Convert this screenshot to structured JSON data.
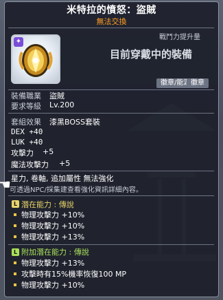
{
  "item": {
    "name": "米特拉的憤怒：盜賊",
    "trade": "無法交換",
    "power_label": "戰鬥力提升量",
    "wearing_label": "目前穿戴中的裝備",
    "tags": [
      "徽章/能源",
      "徽章"
    ]
  },
  "stats": {
    "job_label": "裝備職業",
    "job_value": "盜賊",
    "level_label": "要求等級",
    "level_value": "Lv.200",
    "set_label": "套組效果",
    "set_value": "漆黑BOSS套裝",
    "dex": "DEX  +40",
    "luk": "LUK  +40",
    "atk_label": "攻擊力",
    "atk_value": "+5",
    "matk_label": "魔法攻擊力",
    "matk_value": "+5",
    "note": "星力, 卷軸, 追加屬性 無法強化",
    "hint": "可透過NPC/採集建查看強化資訊詳細內容。"
  },
  "potential": {
    "badge": "L",
    "title": "潛在能力 : 傳說",
    "lines": [
      "物理攻擊力 +10%",
      "物理攻擊力 +10%",
      "物理攻擊力 +13%"
    ]
  },
  "additional": {
    "badge": "L",
    "title": "附加潛在能力 : 傳說",
    "lines": [
      "物理攻擊力 +13%",
      "攻擊時有15%機率恢復100 MP",
      "物理攻擊力 +10%"
    ]
  },
  "colors": {
    "title": "#ffffff",
    "trade": "#ff9d24",
    "potential": "#e9d46b",
    "additional": "#a9e05a"
  }
}
